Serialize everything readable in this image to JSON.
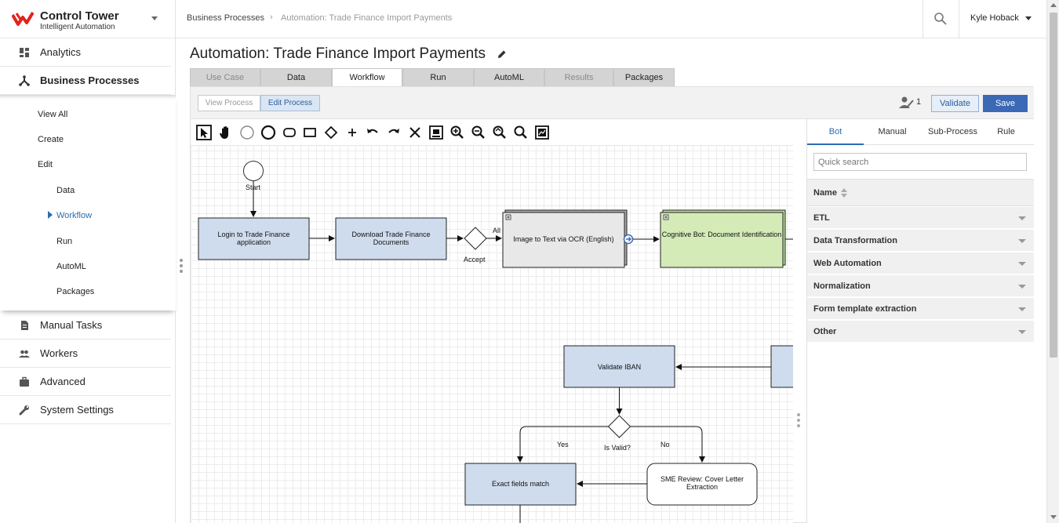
{
  "app": {
    "title": "Control Tower",
    "subtitle": "Intelligent Automation"
  },
  "sidebar": {
    "items": [
      {
        "label": "Analytics",
        "icon": "dashboard-icon"
      },
      {
        "label": "Business Processes",
        "icon": "process-icon"
      },
      {
        "label": "Manual Tasks",
        "icon": "document-icon"
      },
      {
        "label": "Workers",
        "icon": "people-icon"
      },
      {
        "label": "Advanced",
        "icon": "briefcase-icon"
      },
      {
        "label": "System Settings",
        "icon": "wrench-icon"
      }
    ],
    "submenu": {
      "view_all": "View All",
      "create": "Create",
      "edit": "Edit",
      "edit_children": [
        "Data",
        "Workflow",
        "Run",
        "AutoML",
        "Packages"
      ],
      "current": "Workflow"
    }
  },
  "header": {
    "breadcrumb": [
      "Business Processes",
      "Automation: Trade Finance Import Payments"
    ],
    "user": "Kyle Hoback"
  },
  "page": {
    "title": "Automation: Trade Finance Import Payments"
  },
  "tabs": [
    {
      "label": "Use Case",
      "state": "disabled"
    },
    {
      "label": "Data",
      "state": "normal"
    },
    {
      "label": "Workflow",
      "state": "active"
    },
    {
      "label": "Run",
      "state": "normal"
    },
    {
      "label": "AutoML",
      "state": "normal"
    },
    {
      "label": "Results",
      "state": "disabled"
    },
    {
      "label": "Packages",
      "state": "normal"
    }
  ],
  "toolbar": {
    "view_process": "View Process",
    "edit_process": "Edit Process",
    "collaborators": "1",
    "validate": "Validate",
    "save": "Save"
  },
  "diagram_tools": [
    "pointer-icon",
    "hand-icon",
    "start-event-icon",
    "end-event-icon",
    "rounded-task-icon",
    "task-icon",
    "gateway-icon",
    "add-icon",
    "undo-icon",
    "redo-icon",
    "delete-icon",
    "fit-icon",
    "zoom-in-icon",
    "zoom-out-icon",
    "zoom-reset-icon",
    "zoom-icon",
    "export-image-icon"
  ],
  "diagram": {
    "start_label": "Start",
    "login_task": [
      "Login to Trade Finance",
      "application"
    ],
    "download_task": [
      "Download Trade Finance",
      "Documents"
    ],
    "accept_label": "Accept",
    "all_label": "All",
    "ocr_task": "Image to Text via OCR (English)",
    "cognitive_task": "Cognitive Bot: Document Identification",
    "validate_iban": "Validate IBAN",
    "is_valid_label": "Is Valid?",
    "yes_label": "Yes",
    "no_label": "No",
    "exact_fields": "Exact fields match",
    "sme_review": [
      "SME Review: Cover Letter",
      "Extraction"
    ],
    "colors": {
      "task_fill": "#cfdcee",
      "cognitive_fill": "#d4ebb8",
      "ocr_fill": "#e8e8e8"
    }
  },
  "palette": {
    "tabs": [
      "Bot",
      "Manual",
      "Sub-Process",
      "Rule"
    ],
    "active_tab": "Bot",
    "search_placeholder": "Quick search",
    "column_header": "Name",
    "categories": [
      "ETL",
      "Data Transformation",
      "Web Automation",
      "Normalization",
      "Form template extraction",
      "Other"
    ]
  },
  "colors": {
    "brand": "#e2231a",
    "accent": "#3c69b5",
    "link": "#2b6cb0"
  }
}
